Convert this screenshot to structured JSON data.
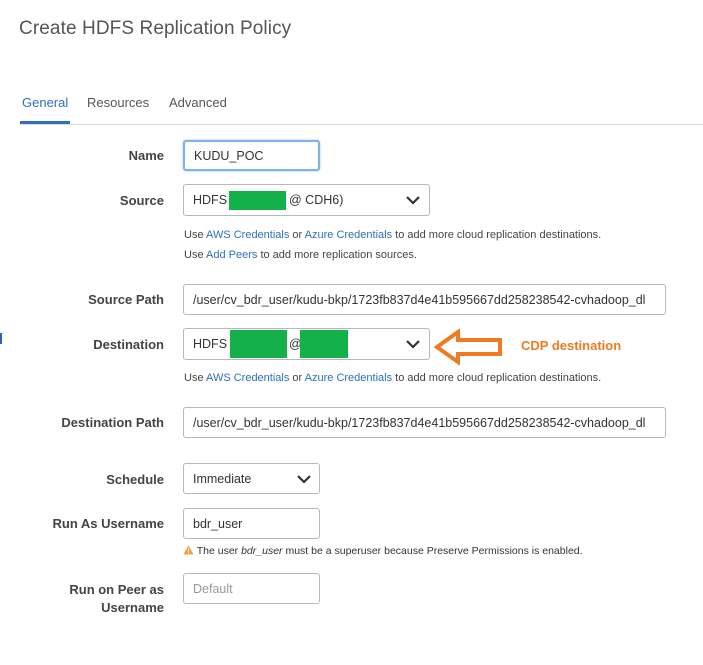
{
  "dialog": {
    "title": "Create HDFS Replication Policy"
  },
  "tabs": [
    {
      "label": "General",
      "active": true
    },
    {
      "label": "Resources",
      "active": false
    },
    {
      "label": "Advanced",
      "active": false
    }
  ],
  "form": {
    "name": {
      "label": "Name",
      "value": "KUDU_POC"
    },
    "source": {
      "label": "Source",
      "value_prefix": "HDFS (",
      "value_suffix": "@ CDH6)"
    },
    "source_help1": {
      "use": "Use",
      "aws": "AWS Credentials",
      "or": "or",
      "azure": "Azure Credentials",
      "rest": "to add more cloud replication destinations."
    },
    "source_help2": {
      "use": "Use",
      "peers": "Add Peers",
      "rest": "to add more replication sources."
    },
    "source_path": {
      "label": "Source Path",
      "value": "/user/cv_bdr_user/kudu-bkp/1723fb837d4e41b595667dd258238542-cvhadoop_dl"
    },
    "destination": {
      "label": "Destination",
      "value_prefix": "HDFS",
      "value_at": "@"
    },
    "destination_help": {
      "use": "Use",
      "aws": "AWS Credentials",
      "or": "or",
      "azure": "Azure Credentials",
      "rest": "to add more cloud replication destinations."
    },
    "destination_path": {
      "label": "Destination Path",
      "value": "/user/cv_bdr_user/kudu-bkp/1723fb837d4e41b595667dd258238542-cvhadoop_dl"
    },
    "schedule": {
      "label": "Schedule",
      "value": "Immediate"
    },
    "run_as": {
      "label": "Run As Username",
      "value": "bdr_user"
    },
    "run_as_warning": {
      "pre": "The user",
      "user": "bdr_user",
      "post": "must be a superuser because Preserve Permissions is enabled."
    },
    "run_on_peer": {
      "label_line1": "Run on Peer as",
      "label_line2": "Username",
      "placeholder": "Default"
    }
  },
  "annotation": {
    "text": "CDP destination",
    "color": "#ee7b22"
  },
  "colors": {
    "accent": "#2f6fba",
    "redaction": "#14b04a",
    "warning": "#f0a030"
  }
}
